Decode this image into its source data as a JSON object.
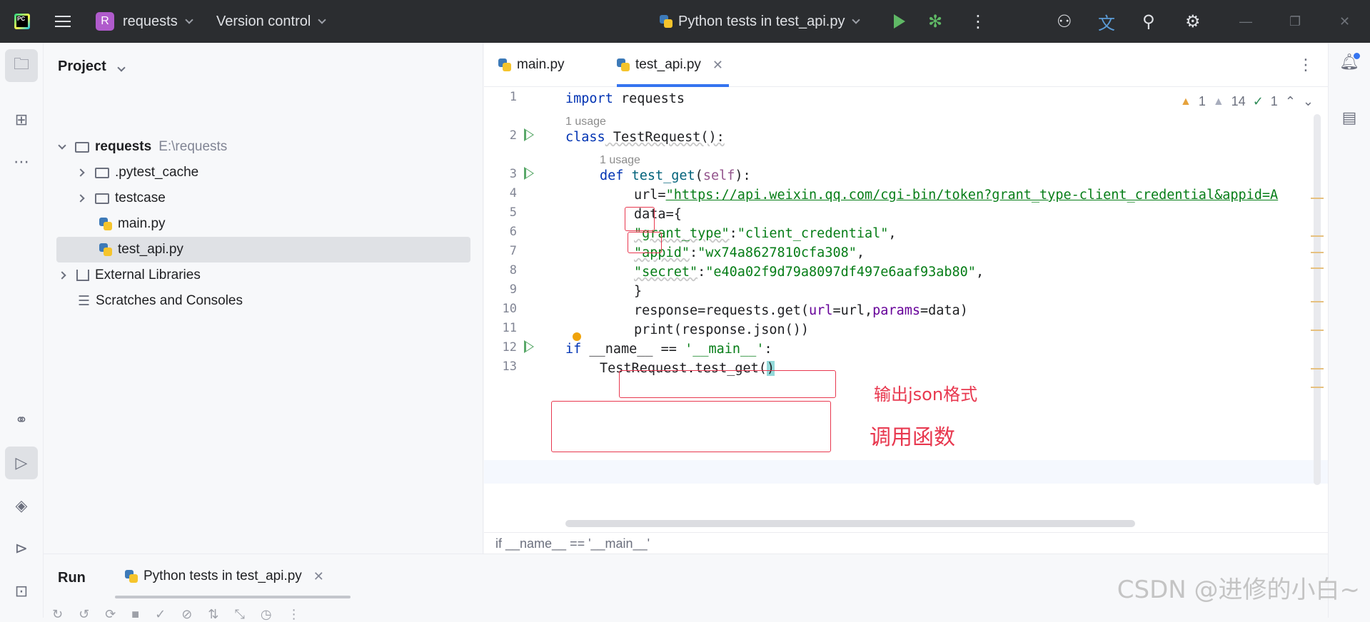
{
  "titlebar": {
    "project_badge": "R",
    "project_name": "requests",
    "vcs_label": "Version control",
    "run_config": "Python tests in test_api.py"
  },
  "project_panel": {
    "title": "Project",
    "tree": [
      {
        "label": "requests",
        "path": "E:\\requests"
      },
      {
        "label": ".pytest_cache"
      },
      {
        "label": "testcase"
      },
      {
        "label": "main.py"
      },
      {
        "label": "test_api.py"
      },
      {
        "label": "External Libraries"
      },
      {
        "label": "Scratches and Consoles"
      }
    ]
  },
  "editor": {
    "tabs": [
      {
        "label": "main.py"
      },
      {
        "label": "test_api.py",
        "active": true
      }
    ],
    "inspections": {
      "warnings": "1",
      "weak_warnings": "14",
      "typos": "1"
    },
    "line_numbers": [
      "1",
      "2",
      "3",
      "4",
      "5",
      "6",
      "7",
      "8",
      "9",
      "10",
      "11",
      "12",
      "13"
    ],
    "usage_hint": "1 usage",
    "code": {
      "l1_kw": "import",
      "l1_rest": " requests",
      "l2_kw": "class",
      "l2_rest": " TestRequest():",
      "l3_kw": "def",
      "l3_fn": "test_get",
      "l3_open": "(",
      "l3_self": "self",
      "l3_close": "):",
      "l4_var": "url",
      "l4_eq": "=",
      "l4_str": "\"https://api.weixin.qq.com/cgi-bin/token?grant_type-client_credential&appid=A",
      "l5_var": "data",
      "l5_rest": "={",
      "l6_key": "\"grant_type\"",
      "l6_colon": ":",
      "l6_val": "\"client_credential\"",
      "l6_comma": ",",
      "l7_key": "\"appid\"",
      "l7_colon": ":",
      "l7_val": "\"wx74a8627810cfa308\"",
      "l7_comma": ",",
      "l8_key": "\"secret\"",
      "l8_colon": ":",
      "l8_val": "\"e40a02f9d79a8097df497e6aaf93ab80\"",
      "l8_comma": ",",
      "l9": "}",
      "l10_a": "response=requests.get(",
      "l10_kw1": "url",
      "l10_b": "=url,",
      "l10_kw2": "params",
      "l10_c": "=data)",
      "l11": "print(response.json())",
      "l12_a": "if",
      "l12_b": " __name__ == ",
      "l12_str": "'__main__'",
      "l12_c": ":",
      "l13_a": "TestRequest.test_get(",
      "l13_b": ")"
    },
    "annotations": {
      "print_note": "输出json格式",
      "call_note": "调用函数"
    },
    "breadcrumb": "if __name__ == '__main__'"
  },
  "run_panel": {
    "title": "Run",
    "tab_label": "Python tests in test_api.py"
  },
  "watermark": "CSDN @进修的小白~"
}
